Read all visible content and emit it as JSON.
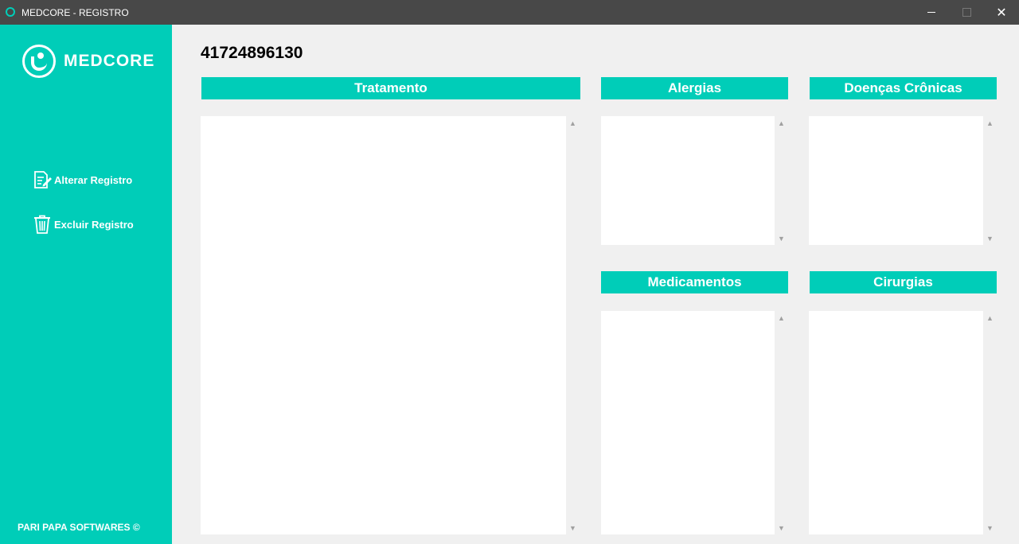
{
  "window": {
    "title": "MEDCORE - REGISTRO",
    "minimize": "—",
    "close": "✕"
  },
  "sidebar": {
    "brand": "MEDCORE",
    "items": [
      {
        "label": "Alterar Registro",
        "icon": "edit-document-icon"
      },
      {
        "label": "Excluir Registro",
        "icon": "trash-icon"
      }
    ],
    "footer": "PARI PAPA SOFTWARES ©"
  },
  "record": {
    "id": "41724896130"
  },
  "sections": {
    "tratamento": {
      "title": "Tratamento",
      "value": ""
    },
    "alergias": {
      "title": "Alergias",
      "value": ""
    },
    "doencas": {
      "title": "Doenças Crônicas",
      "value": ""
    },
    "medicamentos": {
      "title": "Medicamentos",
      "value": ""
    },
    "cirurgias": {
      "title": "Cirurgias",
      "value": ""
    }
  },
  "colors": {
    "accent": "#00cdb8",
    "titlebar": "#484848",
    "background": "#f0f0f0"
  }
}
